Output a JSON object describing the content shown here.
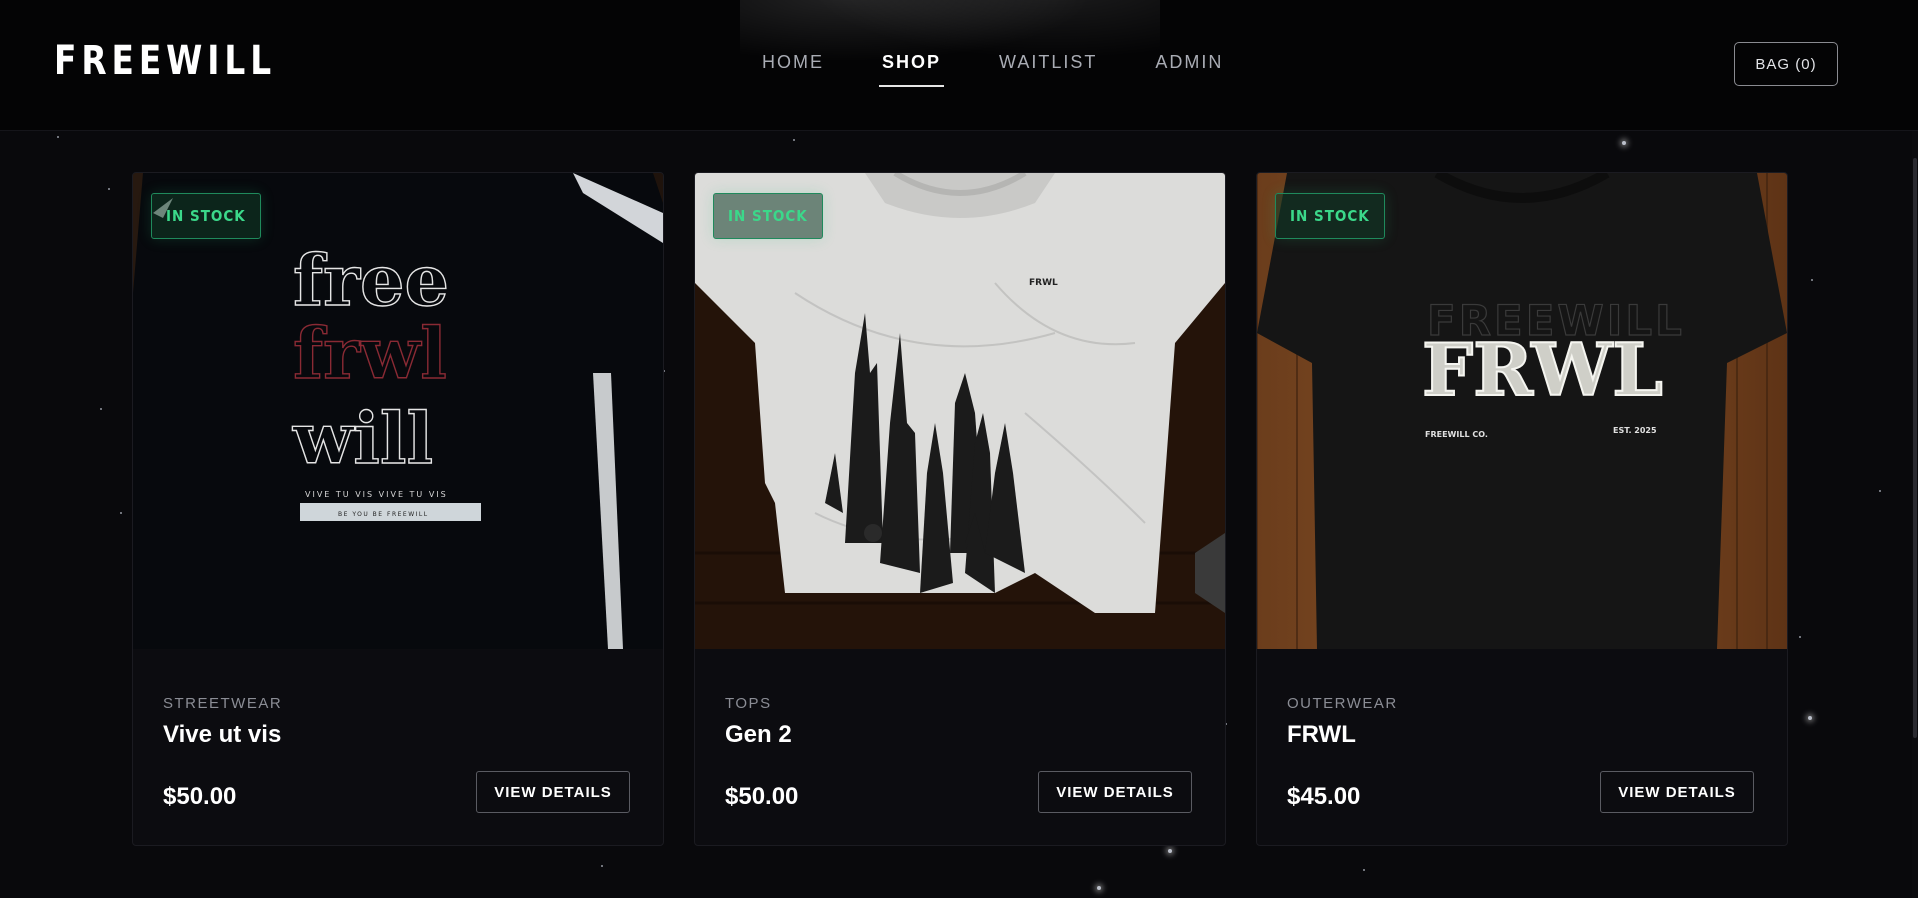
{
  "header": {
    "logo": "FREEWILL",
    "nav": [
      {
        "label": "HOME",
        "active": false
      },
      {
        "label": "SHOP",
        "active": true
      },
      {
        "label": "WAITLIST",
        "active": false
      },
      {
        "label": "ADMIN",
        "active": false
      }
    ],
    "bag_label": "BAG (0)"
  },
  "products": [
    {
      "badge": "IN STOCK",
      "category": "STREETWEAR",
      "name": "Vive ut vis",
      "price": "$50.00",
      "button": "VIEW DETAILS",
      "print_text": [
        "free",
        "frwl",
        "will"
      ],
      "print_line": "VIVE TU VIS VIVE TU VIS",
      "print_tag": "BE YOU BE FREEWILL"
    },
    {
      "badge": "IN STOCK",
      "category": "TOPS",
      "name": "Gen 2",
      "price": "$50.00",
      "button": "VIEW DETAILS",
      "print_tag": "FRWL"
    },
    {
      "badge": "IN STOCK",
      "category": "OUTERWEAR",
      "name": "FRWL",
      "price": "$45.00",
      "button": "VIEW DETAILS",
      "print_top": "FREEWILL",
      "print_main": "FRWL",
      "print_left": "FREEWILL CO.",
      "print_right": "EST. 2025"
    }
  ],
  "colors": {
    "background": "#09090c",
    "badge_green": "#3bd88a",
    "card": "#0c0c10"
  }
}
